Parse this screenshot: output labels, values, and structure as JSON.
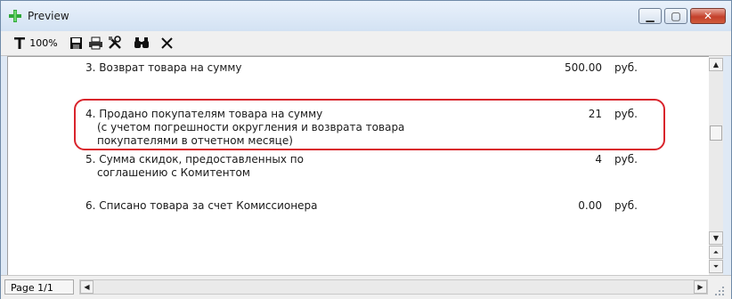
{
  "window": {
    "title": "Preview"
  },
  "toolbar": {
    "zoom_label": "100%"
  },
  "report": {
    "rows": [
      {
        "label_lines": [
          "3. Возврат товара на сумму"
        ],
        "value": "500.00",
        "unit": "руб."
      },
      {
        "label_lines": [
          "4. Продано покупателям товара на сумму",
          "(с учетом  погрешности округления и возврата товара",
          "покупателями в отчетном месяце)"
        ],
        "value": "21",
        "unit": "руб.",
        "highlighted": true
      },
      {
        "label_lines": [
          "5. Сумма скидок, предоставленных по",
          "соглашению с Комитентом"
        ],
        "value": "4",
        "unit": "руб."
      },
      {
        "label_lines": [
          "6. Списано товара за счет Комиссионера"
        ],
        "value": "0.00",
        "unit": "руб."
      }
    ]
  },
  "status": {
    "page": "Page 1/1"
  },
  "colors": {
    "highlight": "#d9242c",
    "close_button": "#c4402b"
  },
  "icons": [
    "app-plus-icon",
    "zoom-icon",
    "save-icon",
    "print-icon",
    "settings-icon",
    "find-icon",
    "close-preview-icon"
  ]
}
